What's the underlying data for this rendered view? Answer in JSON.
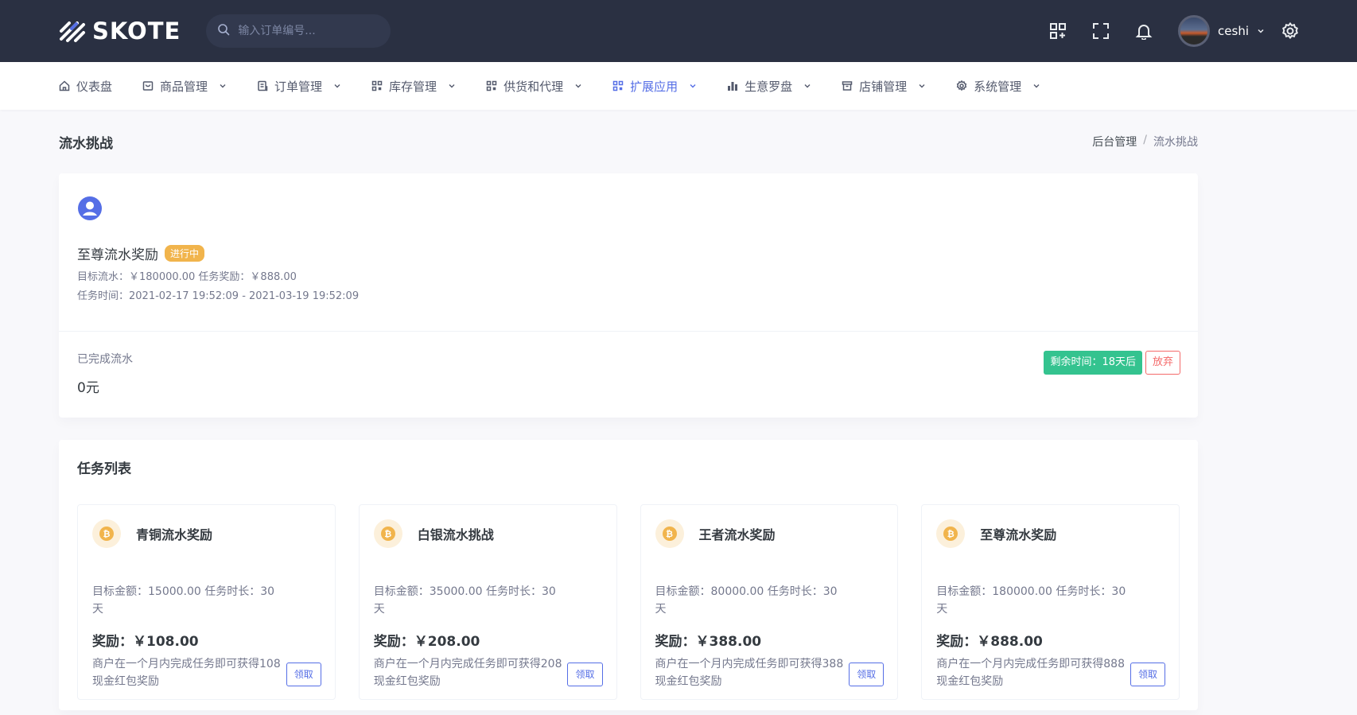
{
  "brand": {
    "name": "SKOTE"
  },
  "search": {
    "placeholder": "输入订单编号..."
  },
  "user": {
    "name": "ceshi"
  },
  "nav": [
    {
      "label": "仪表盘",
      "icon": "home-icon",
      "has_dropdown": false
    },
    {
      "label": "商品管理",
      "icon": "inbox-icon",
      "has_dropdown": true
    },
    {
      "label": "订单管理",
      "icon": "receipt-icon",
      "has_dropdown": true
    },
    {
      "label": "库存管理",
      "icon": "grid-icon",
      "has_dropdown": true
    },
    {
      "label": "供货和代理",
      "icon": "grid-icon",
      "has_dropdown": true
    },
    {
      "label": "扩展应用",
      "icon": "grid-icon",
      "has_dropdown": true,
      "active": true
    },
    {
      "label": "生意罗盘",
      "icon": "bar-chart-icon",
      "has_dropdown": true
    },
    {
      "label": "店铺管理",
      "icon": "archive-icon",
      "has_dropdown": true
    },
    {
      "label": "系统管理",
      "icon": "gear-icon",
      "has_dropdown": true
    }
  ],
  "page": {
    "title": "流水挑战",
    "breadcrumb": [
      "后台管理",
      "流水挑战"
    ]
  },
  "current_challenge": {
    "name": "至尊流水奖励",
    "status": "进行中",
    "target_line": "目标流水：￥180000.00  任务奖励：￥888.00",
    "time_line": "任务时间：2021-02-17 19:52:09 - 2021-03-19 19:52:09",
    "done_label": "已完成流水",
    "done_value": "0元",
    "remaining": "剩余时间：18天后",
    "abandon_label": "放弃"
  },
  "task_list": {
    "title": "任务列表",
    "claim_label": "领取",
    "items": [
      {
        "name": "青铜流水奖励",
        "target": "目标金额：15000.00 任务时长：30天",
        "reward": "奖励：￥108.00",
        "desc": "商户在一个月内完成任务即可获得108现金红包奖励"
      },
      {
        "name": "白银流水挑战",
        "target": "目标金额：35000.00 任务时长：30天",
        "reward": "奖励：￥208.00",
        "desc": "商户在一个月内完成任务即可获得208现金红包奖励"
      },
      {
        "name": "王者流水奖励",
        "target": "目标金额：80000.00 任务时长：30天",
        "reward": "奖励：￥388.00",
        "desc": "商户在一个月内完成任务即可获得388现金红包奖励"
      },
      {
        "name": "至尊流水奖励",
        "target": "目标金额：180000.00 任务时长：30天",
        "reward": "奖励：￥888.00",
        "desc": "商户在一个月内完成任务即可获得888现金红包奖励"
      }
    ]
  },
  "colors": {
    "topbar": "#2a3042",
    "accent": "#556ee6",
    "success": "#34c38f",
    "warning": "#f1b44c",
    "danger": "#f46a6a"
  }
}
